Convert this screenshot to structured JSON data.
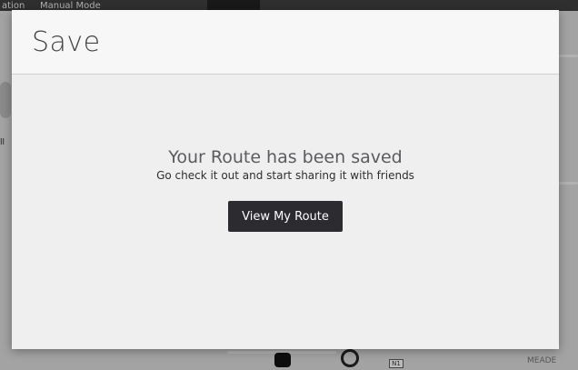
{
  "background": {
    "tabs": [
      "ation",
      "Manual Mode"
    ],
    "side_label": "ll",
    "map_labels": [
      "MEADE"
    ],
    "shield": "N1"
  },
  "modal": {
    "title": "Save",
    "headline": "Your Route has been saved",
    "subtext": "Go check it out and start sharing it with friends",
    "button_label": "View My Route"
  },
  "colors": {
    "modal_bg": "#efeff0",
    "header_bg": "#f7f7f7",
    "button_bg": "#2b2b30",
    "button_text": "#ffffff"
  },
  "icons": {
    "bus": "bus-icon"
  }
}
